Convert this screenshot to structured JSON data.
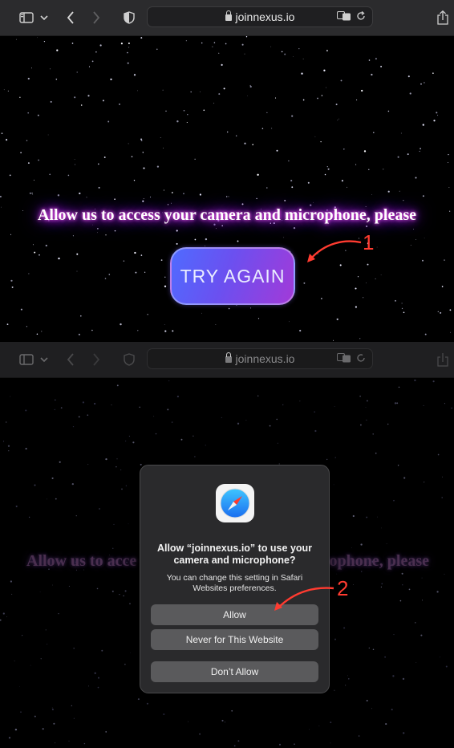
{
  "browser_top": {
    "address": "joinnexus.io"
  },
  "browser_bottom": {
    "address": "joinnexus.io"
  },
  "page_top": {
    "headline": "Allow us to access your camera and microphone, please",
    "try_again_label": "TRY AGAIN",
    "annotation": "1"
  },
  "page_bottom": {
    "headline_left": "Allow us to acce",
    "headline_right": "rophone, please",
    "annotation": "2"
  },
  "dialog": {
    "title": "Allow “joinnexus.io” to use your camera and microphone?",
    "message": "You can change this setting in Safari Websites preferences.",
    "allow_label": "Allow",
    "never_label": "Never for This Website",
    "dont_allow_label": "Don’t Allow"
  },
  "colors": {
    "annotation": "#ff3b30",
    "glow": "#c43bff",
    "button_gradient_start": "#4f6bff",
    "button_gradient_end": "#a23ad8"
  }
}
